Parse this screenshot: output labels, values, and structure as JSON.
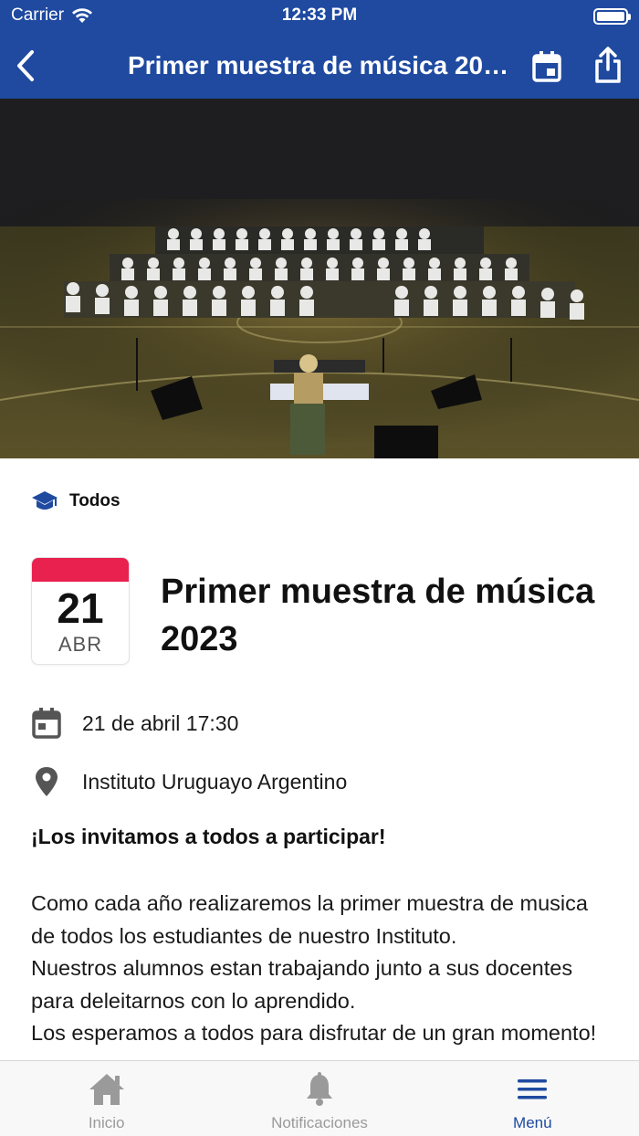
{
  "status_bar": {
    "carrier": "Carrier",
    "time": "12:33 PM"
  },
  "navbar": {
    "title": "Primer muestra de música 2023",
    "icons": [
      "back-icon",
      "calendar-icon",
      "share-icon"
    ]
  },
  "category": {
    "label": "Todos",
    "icon": "graduation-cap-icon"
  },
  "event": {
    "day": "21",
    "month": "ABR",
    "title": "Primer muestra de música 2023",
    "datetime": "21 de abril 17:30",
    "location": "Instituto Uruguayo Argentino",
    "invite": "¡Los invitamos a todos a participar!",
    "description": [
      "Como cada año realizaremos la primer muestra de musica de todos los estudiantes de nuestro Instituto.",
      "Nuestros alumnos estan trabajando junto a sus docentes para deleitarnos con lo aprendido.",
      "Los esperamos a todos para disfrutar de un gran momento!"
    ]
  },
  "tabbar": {
    "tabs": [
      {
        "label": "Inicio",
        "icon": "home-icon",
        "active": false
      },
      {
        "label": "Notificaciones",
        "icon": "bell-icon",
        "active": false
      },
      {
        "label": "Menú",
        "icon": "menu-icon",
        "active": true
      }
    ]
  },
  "colors": {
    "brand": "#1f4aa0",
    "date_band": "#e8214f",
    "inactive_tab": "#9a9a9a"
  }
}
